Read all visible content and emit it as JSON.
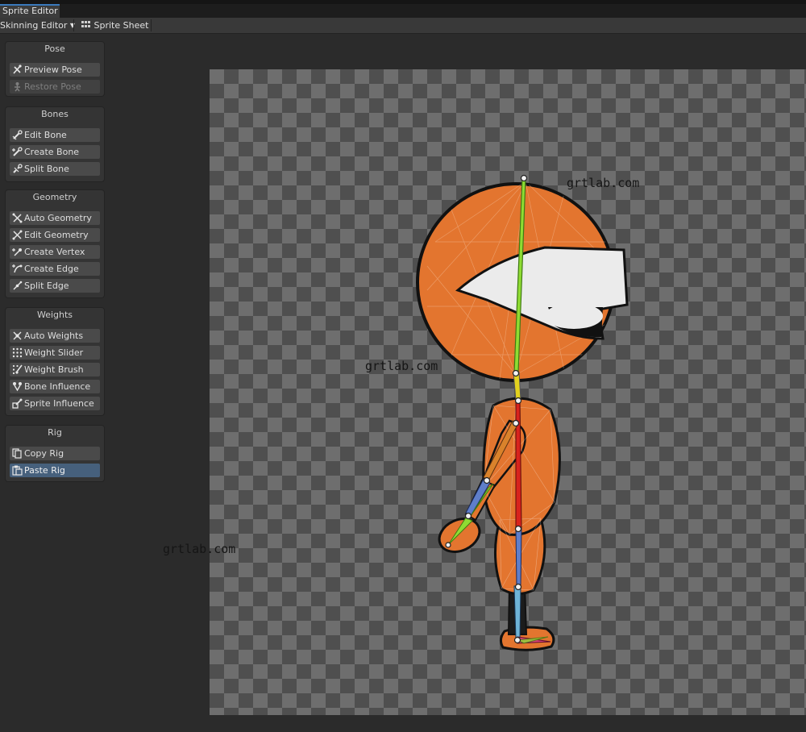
{
  "window": {
    "tab_title": "Sprite Editor"
  },
  "toolbar": {
    "mode_label": "Skinning Editor",
    "sprite_sheet_label": "Sprite Sheet"
  },
  "panels": {
    "pose": {
      "title": "Pose",
      "tools": [
        {
          "label": "Preview Pose",
          "icon": "preview-pose-icon"
        },
        {
          "label": "Restore Pose",
          "icon": "restore-pose-icon",
          "disabled": true
        }
      ]
    },
    "bones": {
      "title": "Bones",
      "tools": [
        {
          "label": "Edit Bone",
          "icon": "edit-bone-icon"
        },
        {
          "label": "Create Bone",
          "icon": "create-bone-icon"
        },
        {
          "label": "Split Bone",
          "icon": "split-bone-icon"
        }
      ]
    },
    "geometry": {
      "title": "Geometry",
      "tools": [
        {
          "label": "Auto Geometry",
          "icon": "auto-geometry-icon"
        },
        {
          "label": "Edit Geometry",
          "icon": "edit-geometry-icon"
        },
        {
          "label": "Create Vertex",
          "icon": "create-vertex-icon"
        },
        {
          "label": "Create Edge",
          "icon": "create-edge-icon"
        },
        {
          "label": "Split Edge",
          "icon": "split-edge-icon"
        }
      ]
    },
    "weights": {
      "title": "Weights",
      "tools": [
        {
          "label": "Auto Weights",
          "icon": "auto-weights-icon"
        },
        {
          "label": "Weight Slider",
          "icon": "weight-slider-icon"
        },
        {
          "label": "Weight Brush",
          "icon": "weight-brush-icon"
        },
        {
          "label": "Bone Influence",
          "icon": "bone-influence-icon"
        },
        {
          "label": "Sprite Influence",
          "icon": "sprite-influence-icon"
        }
      ]
    },
    "rig": {
      "title": "Rig",
      "tools": [
        {
          "label": "Copy Rig",
          "icon": "copy-rig-icon"
        },
        {
          "label": "Paste Rig",
          "icon": "paste-rig-icon",
          "active": true
        }
      ]
    }
  },
  "watermarks": [
    "grtlab.com",
    "grtlab.com",
    "grtlab.com"
  ],
  "colors": {
    "accent": "#3a79bb",
    "active_tool": "#46607c",
    "sprite_orange": "#e3752f"
  }
}
